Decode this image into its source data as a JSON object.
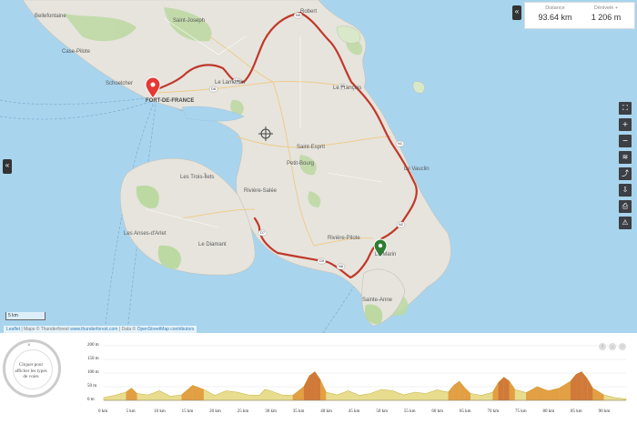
{
  "map": {
    "places": [
      {
        "id": "bellefontaine",
        "label": "Bellefontaine"
      },
      {
        "id": "saint-joseph",
        "label": "Saint-Joseph"
      },
      {
        "id": "robert",
        "label": "Robert"
      },
      {
        "id": "case-pilote",
        "label": "Case-Pilote"
      },
      {
        "id": "schoelcher",
        "label": "Schoelcher"
      },
      {
        "id": "fort-de-france",
        "label": "FORT-DE-FRANCE"
      },
      {
        "id": "lamentin",
        "label": "Le Lamentin"
      },
      {
        "id": "le-francois",
        "label": "Le François"
      },
      {
        "id": "saint-esprit",
        "label": "Saint-Esprit"
      },
      {
        "id": "petit-bourg",
        "label": "Petit-Bourg"
      },
      {
        "id": "le-vauclin",
        "label": "Le Vauclin"
      },
      {
        "id": "trois-ilets",
        "label": "Les Trois-Îlets"
      },
      {
        "id": "riviere-salee",
        "label": "Rivière-Salée"
      },
      {
        "id": "anses-darlet",
        "label": "Les Anses-d'Arlet"
      },
      {
        "id": "le-diamant",
        "label": "Le Diamant"
      },
      {
        "id": "riviere-pilote",
        "label": "Rivière-Pilote"
      },
      {
        "id": "le-marin",
        "label": "Le Marin"
      },
      {
        "id": "sainte-anne",
        "label": "Sainte-Anne"
      }
    ],
    "road_badges": [
      "N6",
      "N5",
      "D5",
      "N1",
      "N2",
      "D7",
      "D9",
      "N6",
      "D8"
    ],
    "scale_label": "5 km",
    "attribution": {
      "leaflet": "Leaflet",
      "maps_text": " | Maps © Thunderforest ",
      "tf_link": "www.thunderforest.com",
      "data_text": " | Data © ",
      "osm_link": "OpenStreetMap contributors"
    },
    "route_color": "#c0392b",
    "start_marker_color": "#e53935",
    "end_marker_color": "#2e7d32"
  },
  "stats": {
    "distance_label": "Distance",
    "distance_value": "93.64 km",
    "elevation_label": "Dénivelé +",
    "elevation_value": "1 206 m"
  },
  "controls": {
    "collapse_right_icon": "«",
    "collapse_left_icon": "«",
    "tools": [
      {
        "name": "fullscreen-icon",
        "glyph": "⛶"
      },
      {
        "name": "zoom-in-icon",
        "glyph": "+"
      },
      {
        "name": "zoom-out-icon",
        "glyph": "−"
      },
      {
        "name": "layers-icon",
        "glyph": "≋"
      },
      {
        "name": "share-icon",
        "glyph": "⤴"
      },
      {
        "name": "export-icon",
        "glyph": "⇩"
      },
      {
        "name": "print-icon",
        "glyph": "⎙"
      },
      {
        "name": "alert-icon",
        "glyph": "⚠"
      }
    ]
  },
  "selector": {
    "close_glyph": "×",
    "text": "Cliquer pour afficher les types de voies"
  },
  "chart_data": {
    "type": "area",
    "x_ticks": [
      "0 km",
      "5 km",
      "10 km",
      "15 km",
      "20 km",
      "25 km",
      "30 km",
      "35 km",
      "40 km",
      "45 km",
      "50 km",
      "55 km",
      "60 km",
      "65 km",
      "70 km",
      "75 km",
      "80 km",
      "85 km",
      "90 km"
    ],
    "y_ticks": [
      "200 m",
      "150 m",
      "100 m",
      "50 m",
      "0 m"
    ],
    "ylim": [
      0,
      200
    ],
    "xlim": [
      0,
      94
    ],
    "x": [
      0,
      2,
      4,
      5,
      6,
      8,
      10,
      12,
      14,
      16,
      18,
      20,
      22,
      24,
      26,
      28,
      29,
      30,
      32,
      34,
      36,
      37,
      38,
      39,
      40,
      42,
      44,
      46,
      48,
      50,
      52,
      54,
      56,
      58,
      60,
      62,
      63,
      64,
      65,
      66,
      68,
      70,
      71,
      72,
      73,
      74,
      76,
      78,
      80,
      82,
      84,
      85,
      86,
      87,
      88,
      90,
      92,
      94
    ],
    "y": [
      10,
      18,
      30,
      45,
      25,
      20,
      35,
      15,
      20,
      55,
      40,
      18,
      35,
      30,
      20,
      18,
      40,
      35,
      20,
      18,
      50,
      90,
      105,
      75,
      30,
      20,
      35,
      18,
      25,
      40,
      35,
      20,
      30,
      25,
      38,
      30,
      55,
      70,
      45,
      25,
      18,
      30,
      65,
      85,
      70,
      40,
      28,
      50,
      35,
      45,
      70,
      95,
      105,
      80,
      45,
      20,
      10,
      5
    ]
  }
}
